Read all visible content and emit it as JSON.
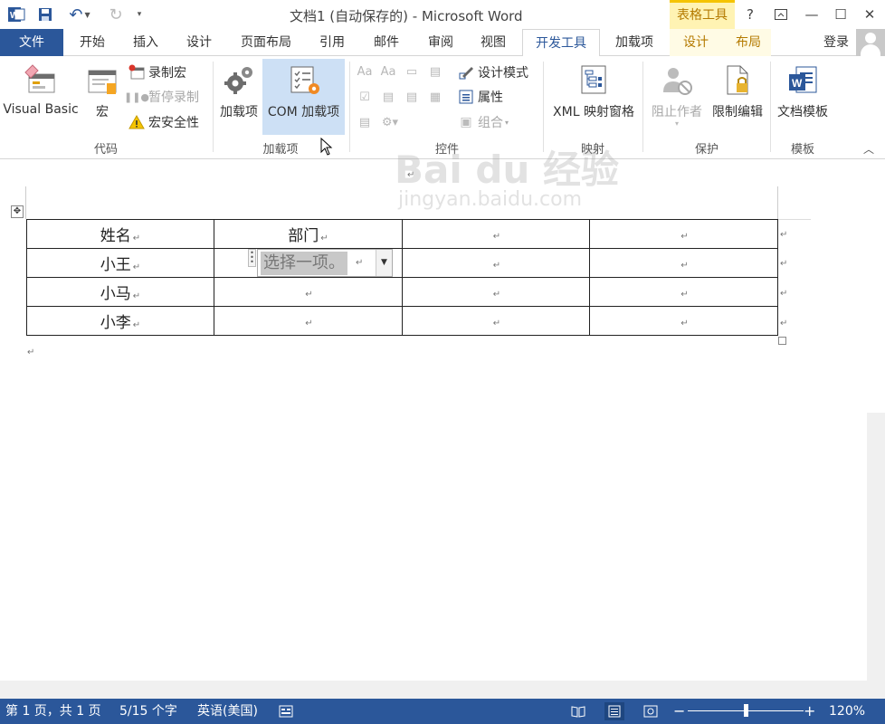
{
  "window": {
    "title": "文档1 (自动保存的) - Microsoft Word",
    "context_group": "表格工具",
    "undo_icon": "undo-icon",
    "redo_icon": "redo-icon",
    "controls": {
      "help": "?",
      "minimize": "—",
      "restore": "☐",
      "close": "✕"
    }
  },
  "tabs": [
    {
      "label": "文件"
    },
    {
      "label": "开始"
    },
    {
      "label": "插入"
    },
    {
      "label": "设计"
    },
    {
      "label": "页面布局"
    },
    {
      "label": "引用"
    },
    {
      "label": "邮件"
    },
    {
      "label": "审阅"
    },
    {
      "label": "视图"
    },
    {
      "label": "开发工具",
      "selected": true
    },
    {
      "label": "加载项"
    },
    {
      "label": "设计",
      "context": true
    },
    {
      "label": "布局",
      "context": true
    }
  ],
  "account": {
    "login": "登录"
  },
  "ribbon": {
    "code": {
      "label": "代码",
      "visual_basic": "Visual Basic",
      "macros": "宏",
      "record_macro": "录制宏",
      "pause_recording": "暂停录制",
      "macro_security": "宏安全性"
    },
    "addins": {
      "label": "加载项",
      "addins": "加载项",
      "com_addins": "COM 加载项"
    },
    "controls": {
      "label": "控件",
      "design_mode": "设计模式",
      "properties": "属性",
      "group": "组合"
    },
    "mapping": {
      "label": "映射",
      "xml_mapping_pane": "XML 映射窗格"
    },
    "protect": {
      "label": "保护",
      "block_authors": "阻止作者",
      "restrict_editing": "限制编辑"
    },
    "templates": {
      "label": "模板",
      "document_template": "文档模板"
    }
  },
  "document": {
    "table": {
      "rows": [
        [
          "姓名",
          "部门",
          "",
          ""
        ],
        [
          "小王",
          "",
          "",
          ""
        ],
        [
          "小马",
          "",
          "",
          ""
        ],
        [
          "小李",
          "",
          "",
          ""
        ]
      ]
    },
    "content_control": {
      "placeholder": "选择一项。"
    },
    "watermark": {
      "brand": "Bai du 经验",
      "url": "jingyan.baidu.com"
    }
  },
  "status_bar": {
    "page": "第 1 页，共 1 页",
    "words": "5/15 个字",
    "language": "英语(美国)",
    "zoom": "120%",
    "zoom_minus": "−",
    "zoom_plus": "+",
    "zoom_level": 1.2
  },
  "colors": {
    "accent": "#2b579a",
    "context_tab_bg": "#fff3b3",
    "context_tab_text": "#b47a00",
    "hover_highlight": "#cde0f5"
  }
}
